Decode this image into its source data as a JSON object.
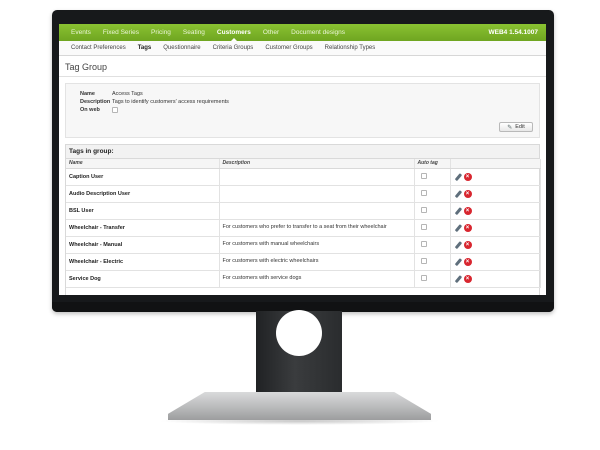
{
  "topnav": {
    "items": [
      "Events",
      "Fixed Series",
      "Pricing",
      "Seating",
      "Customers",
      "Other",
      "Document designs"
    ],
    "active": "Customers",
    "version": "WEB4 1.54.1007"
  },
  "subnav": {
    "items": [
      "Contact Preferences",
      "Tags",
      "Questionnaire",
      "Criteria Groups",
      "Customer Groups",
      "Relationship Types"
    ],
    "active": "Tags"
  },
  "page": {
    "title": "Tag Group"
  },
  "group": {
    "name_label": "Name",
    "name_value": "Access Tags",
    "description_label": "Description",
    "description_value": "Tags to identify customers' access requirements",
    "on_web_label": "On web",
    "edit_label": "Edit"
  },
  "tags": {
    "header": "Tags in group:",
    "columns": [
      "Name",
      "Description",
      "Auto tag",
      ""
    ],
    "rows": [
      {
        "name": "Caption User",
        "description": ""
      },
      {
        "name": "Audio Description User",
        "description": ""
      },
      {
        "name": "BSL User",
        "description": ""
      },
      {
        "name": "Wheelchair - Transfer",
        "description": "For customers who prefer to transfer to a seat from their wheelchair"
      },
      {
        "name": "Wheelchair - Manual",
        "description": "For customers with manual wheelchairs"
      },
      {
        "name": "Wheelchair - Electric",
        "description": "For customers with electric wheelchairs"
      },
      {
        "name": "Service Dog",
        "description": "For customers with service dogs"
      }
    ]
  },
  "icons": {
    "edit": "pencil-icon",
    "delete": "delete-icon"
  },
  "colors": {
    "nav_green": "#7ab428",
    "delete_red": "#d8262f"
  }
}
